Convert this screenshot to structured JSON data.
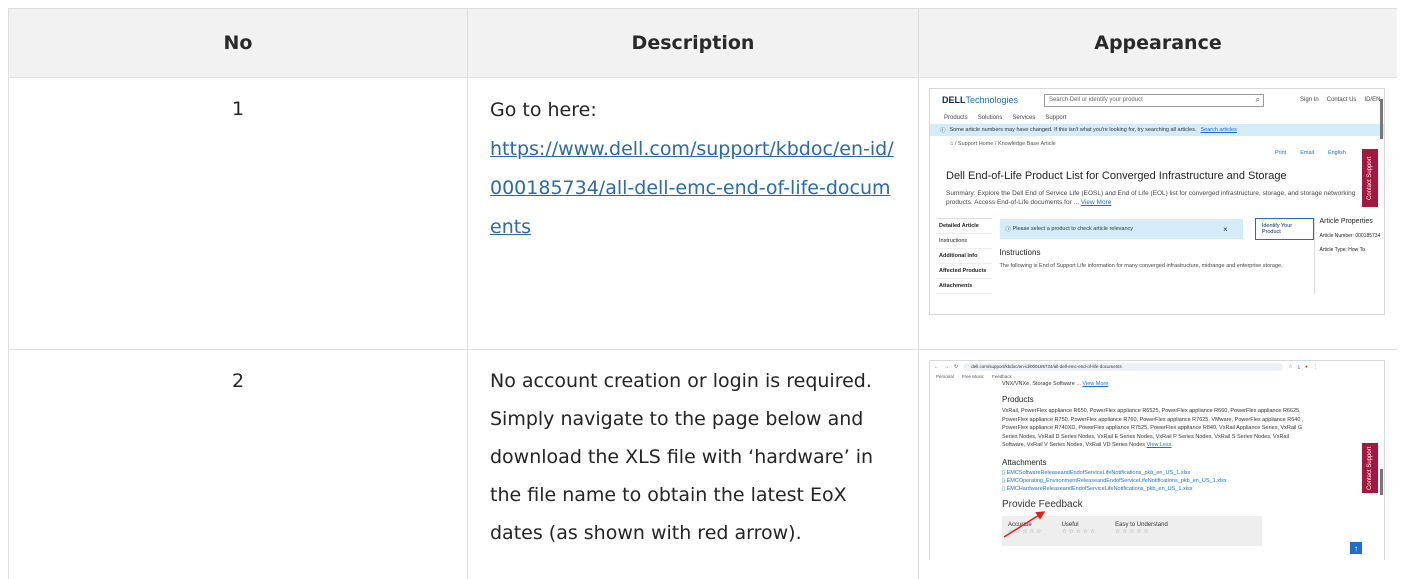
{
  "table": {
    "headers": [
      "No",
      "Description",
      "Appearance"
    ],
    "rows": [
      {
        "no": "1",
        "desc_prefix": "Go to here:",
        "link": "https://www.dell.com/support/kbdoc/en-id/000185734/all-dell-emc-end-of-life-documents"
      },
      {
        "no": "2",
        "desc": "No account creation or login is required. Simply navigate to the page below and download the XLS file with ‘hardware’ in the file name to obtain the latest EoX dates (as shown with red arrow)."
      }
    ]
  },
  "shot1": {
    "logo_bold": "DELL",
    "logo_rest": "Technologies",
    "search_placeholder": "Search Dell or identify your product",
    "sign_in": "Sign In",
    "contact_us": "Contact Us",
    "locale": "ID/EN",
    "nav": [
      "Products",
      "Solutions",
      "Services",
      "Support"
    ],
    "banner_text": "Some article numbers may have changed. If this isn't what you're looking for, try searching all articles.",
    "banner_link": "Search articles",
    "breadcrumb": "⌂  /  Support Home  /  Knowledge Base Article",
    "tools": [
      "Print",
      "Email",
      "English"
    ],
    "title": "Dell End-of-Life Product List for Converged Infrastructure and Storage",
    "summary": "Summary: Explore the Dell End of Service Life (EOSL) and End of Life (EOL) list for converged infrastructure, storage, and storage networking products. Access End-of-Life documents for ...",
    "view_more": "View More",
    "side_items": [
      "Detailed Article",
      "Instructions",
      "Additional Info",
      "Affected Products",
      "Attachments"
    ],
    "alert": "Please select a product to check article relevancy",
    "identify_btn": "Identify Your Product",
    "instructions_h": "Instructions",
    "instructions_text": "The following is End of Support Life information for many converged infrastructure, midrange and enterprise storage,",
    "props_title": "Article Properties",
    "props_number": "Article Number: 000185734",
    "props_type": "Article Type: How To",
    "contact_support": "Contact Support"
  },
  "shot2": {
    "url": "dell.com/support/kbdoc/en-id/000185734/all-dell-emc-end-of-life-documents",
    "bookmarks": [
      "Personal",
      "Free Music",
      "Feedback"
    ],
    "top_line": "VNX/VNXe, Storage Software ...",
    "view_more": "View More",
    "products_h": "Products",
    "products_text": "VxRail, PowerFlex appliance R650, PowerFlex appliance R6525, PowerFlex appliance R660, PowerFlex appliance R6625, PowerFlex appliance R750, PowerFlex appliance R760, PowerFlex appliance R7625, VMware, PowerFlex appliance R640 , PowerFlex appliance R740XD, PowerFlex appliance R7525, PowerFlex appliance R840, VxRail Appliance Series, VxRail G Series Nodes, VxRail D Series Nodes, VxRail E Series Nodes, VxRail P Series Nodes, VxRail S Series Nodes, VxRail Software, VxRail V Series Nodes, VxRail VD Series Nodes",
    "view_less": "View Less",
    "attachments_h": "Attachments",
    "attachments": [
      "EMCSoftwareReleaseandEndofServiceLifeNotifications_pkb_en_US_1.xlsx",
      "EMCOperating_EnvironmentReleaseandEndofServiceLifeNotifications_pkb_en_US_1.xlsx",
      "EMCHardwareReleaseandEndofServiceLifeNotifications_pkb_en_US_1.xlsx"
    ],
    "feedback_h": "Provide Feedback",
    "ratings": [
      "Accurate",
      "Useful",
      "Easy to Understand"
    ],
    "stars": "☆ ☆ ☆ ☆ ☆",
    "contact_support": "Contact Support",
    "arrow_color": "#e02020"
  }
}
